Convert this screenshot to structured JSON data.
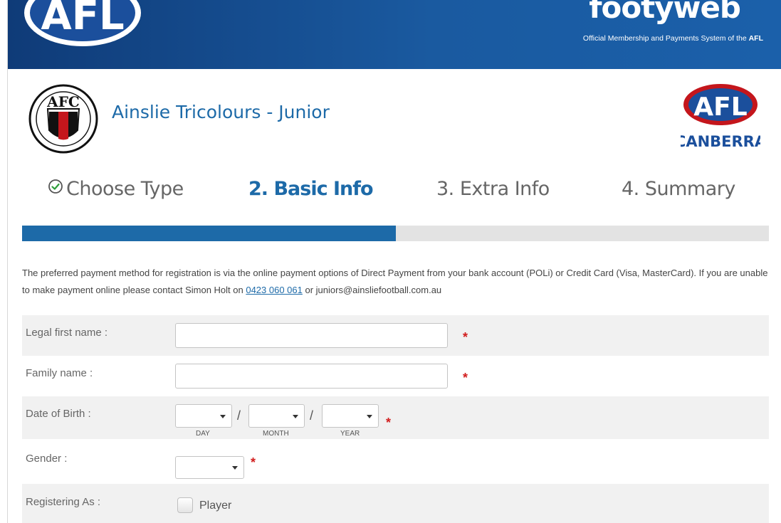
{
  "header": {
    "afl_logo_text": "AFL",
    "brand_name": "footyweb",
    "brand_tagline_prefix": "Official Membership and Payments System of the ",
    "brand_tagline_bold": "AFL"
  },
  "club": {
    "logo_text": "AFC",
    "title": "Ainslie Tricolours - Junior",
    "partner_logo_text": "AFL",
    "partner_logo_sub": "CANBERRA"
  },
  "steps": [
    {
      "label": "Choose Type",
      "state": "completed"
    },
    {
      "label": "2. Basic Info",
      "state": "current"
    },
    {
      "label": "3. Extra Info",
      "state": "upcoming"
    },
    {
      "label": "4. Summary",
      "state": "upcoming"
    }
  ],
  "progress": {
    "fraction": 0.5
  },
  "intro": {
    "text_before": "The preferred payment method for registration is via the online payment options of Direct Payment from your bank account (POLi) or Credit Card (Visa, MasterCard). If you are unable to make payment online please contact Simon Holt on ",
    "phone_link": "0423 060 061",
    "text_after": " or juniors@ainsliefootball.com.au"
  },
  "form": {
    "required_marker": "*",
    "first_name": {
      "label": "Legal first name :",
      "value": ""
    },
    "family_name": {
      "label": "Family name :",
      "value": ""
    },
    "dob": {
      "label": "Date of Birth :",
      "separator": "/",
      "day_label": "DAY",
      "month_label": "MONTH",
      "year_label": "YEAR",
      "day_value": "",
      "month_value": "",
      "year_value": ""
    },
    "gender": {
      "label": "Gender :",
      "value": ""
    },
    "registering_as": {
      "label": "Registering As :",
      "option_player": "Player",
      "player_checked": false
    }
  },
  "colors": {
    "header_blue": "#0f3b78",
    "accent_blue": "#1d6aa8",
    "required_red": "#d21e1e"
  }
}
